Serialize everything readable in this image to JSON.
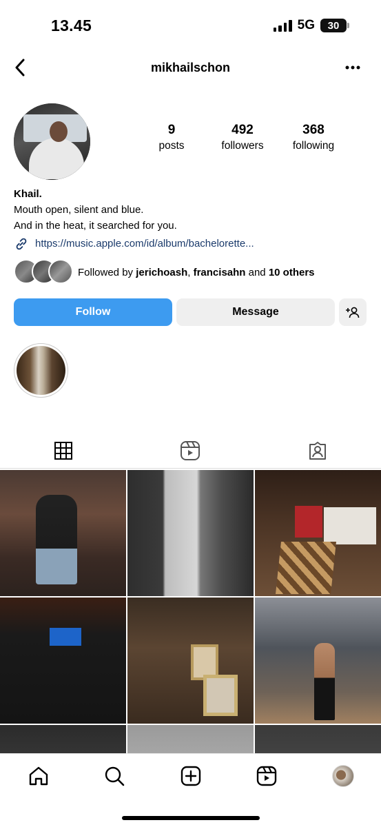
{
  "status_bar": {
    "time": "13.45",
    "network": "5G",
    "battery": "30"
  },
  "header": {
    "username": "mikhailschon"
  },
  "profile": {
    "stats": [
      {
        "value": "9",
        "label": "posts"
      },
      {
        "value": "492",
        "label": "followers"
      },
      {
        "value": "368",
        "label": "following"
      }
    ],
    "name": "Khail.",
    "bio_lines": [
      "Mouth open, silent and blue.",
      "And in the heat, it searched for you."
    ],
    "link": "https://music.apple.com/id/album/bachelorette..."
  },
  "followed_by": {
    "prefix": "Followed by ",
    "user1": "jerichoash",
    "separator": ", ",
    "user2": "francisahn",
    "conj": " and ",
    "others": "10 others"
  },
  "actions": {
    "follow_label": "Follow",
    "message_label": "Message"
  },
  "tabs": [
    {
      "icon": "grid-icon",
      "active": true
    },
    {
      "icon": "reels-icon",
      "active": false
    },
    {
      "icon": "tagged-icon",
      "active": false
    }
  ],
  "bottom_nav": [
    "home-icon",
    "search-icon",
    "create-icon",
    "reels-icon",
    "profile-avatar"
  ],
  "colors": {
    "follow_button": "#3d9bf0",
    "secondary_button": "#efefef",
    "link_text": "#1a3a6b"
  }
}
